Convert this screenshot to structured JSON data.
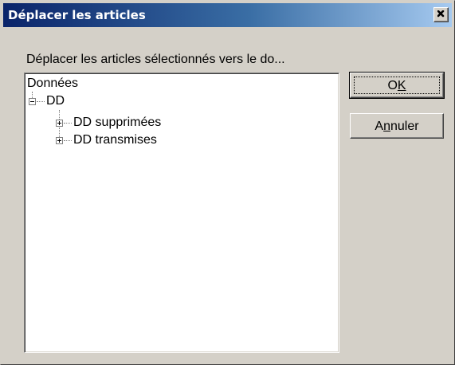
{
  "window": {
    "title": "Déplacer les articles",
    "close_glyph": "×"
  },
  "dialog": {
    "prompt": "Déplacer les articles sélectionnés vers le do..."
  },
  "tree": {
    "root": "Données",
    "children": [
      {
        "label": "DD",
        "expanded": true,
        "children": [
          {
            "label": "DD supprimées",
            "expanded": false
          },
          {
            "label": "DD transmises",
            "expanded": false
          }
        ]
      }
    ]
  },
  "buttons": {
    "ok_prefix": "O",
    "ok_accel": "K",
    "cancel_prefix": "A",
    "cancel_accel": "n",
    "cancel_suffix": "nuler"
  },
  "colors": {
    "title_gradient_start": "#0a246a",
    "title_gradient_end": "#a6caf0",
    "face": "#d4d0c8"
  }
}
